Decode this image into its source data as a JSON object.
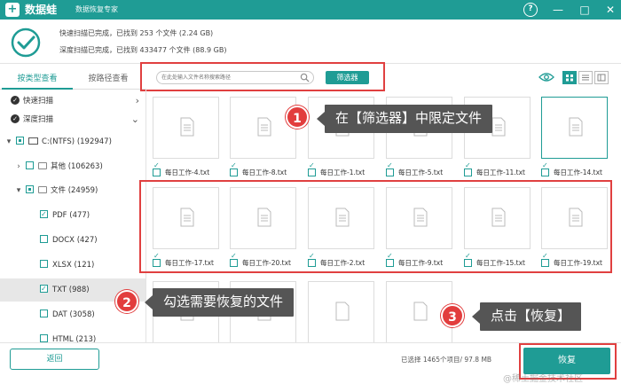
{
  "app": {
    "name": "数据蛙",
    "subtitle": "数据恢复专家",
    "logo_glyph": "+"
  },
  "window_controls": {
    "help": "?",
    "minimize": "—",
    "maximize": "□",
    "close": "✕"
  },
  "summary": {
    "quick_scan": "快速扫描已完成，已找到 253 个文件 (2.24 GB)",
    "deep_scan": "深度扫描已完成，已找到 433477 个文件 (88.9 GB)"
  },
  "tabs": [
    {
      "label": "按类型查看",
      "active": true
    },
    {
      "label": "按路径查看",
      "active": false
    }
  ],
  "search": {
    "placeholder": "在此处输入文件名称搜索路径",
    "filter_label": "筛选器"
  },
  "tree": [
    {
      "label": "快速扫描",
      "kind": "scan",
      "chevron": "›"
    },
    {
      "label": "深度扫描",
      "kind": "scan",
      "chevron": "⌄"
    },
    {
      "label": "C:(NTFS) (192947)",
      "kind": "drive",
      "expand": "▾"
    },
    {
      "label": "其他 (106263)",
      "kind": "folder",
      "expand": "›"
    },
    {
      "label": "文件 (24959)",
      "kind": "folder",
      "expand": "▾"
    },
    {
      "label": "PDF (477)",
      "kind": "type",
      "checked": true
    },
    {
      "label": "DOCX (427)",
      "kind": "type",
      "checked": false
    },
    {
      "label": "XLSX (121)",
      "kind": "type",
      "checked": false
    },
    {
      "label": "TXT (988)",
      "kind": "type",
      "checked": true,
      "highlight": true
    },
    {
      "label": "DAT (3058)",
      "kind": "type",
      "checked": false
    },
    {
      "label": "HTML (213)",
      "kind": "type",
      "checked": false
    }
  ],
  "files": [
    {
      "name": "每日工作-4.txt",
      "checked": true
    },
    {
      "name": "每日工作-8.txt",
      "checked": true
    },
    {
      "name": "每日工作-1.txt",
      "checked": true
    },
    {
      "name": "每日工作-5.txt",
      "checked": true
    },
    {
      "name": "每日工作-11.txt",
      "checked": true
    },
    {
      "name": "每日工作-14.txt",
      "checked": true,
      "selected": true
    },
    {
      "name": "每日工作-17.txt",
      "checked": true
    },
    {
      "name": "每日工作-20.txt",
      "checked": true
    },
    {
      "name": "每日工作-2.txt",
      "checked": true
    },
    {
      "name": "每日工作-9.txt",
      "checked": true
    },
    {
      "name": "每日工作-15.txt",
      "checked": true
    },
    {
      "name": "每日工作-19.txt",
      "checked": true
    },
    {
      "name": "",
      "checked": false
    },
    {
      "name": "",
      "checked": false
    },
    {
      "name": "",
      "checked": false
    },
    {
      "name": "",
      "checked": false
    },
    {
      "name": "",
      "checked": false
    },
    {
      "name": "",
      "checked": false
    }
  ],
  "callouts": [
    {
      "number": "1",
      "text": "在【筛选器】中限定文件"
    },
    {
      "number": "2",
      "text": "勾选需要恢复的文件"
    },
    {
      "number": "3",
      "text": "点击【恢复】"
    }
  ],
  "footer": {
    "back_label": "返回",
    "selected_info": "已选择 1465个项目/ 97.8 MB",
    "recover_label": "恢复",
    "watermark": "@稀土掘金技术社区"
  },
  "colors": {
    "brand": "#1f9c95",
    "annotation": "#e04040"
  }
}
